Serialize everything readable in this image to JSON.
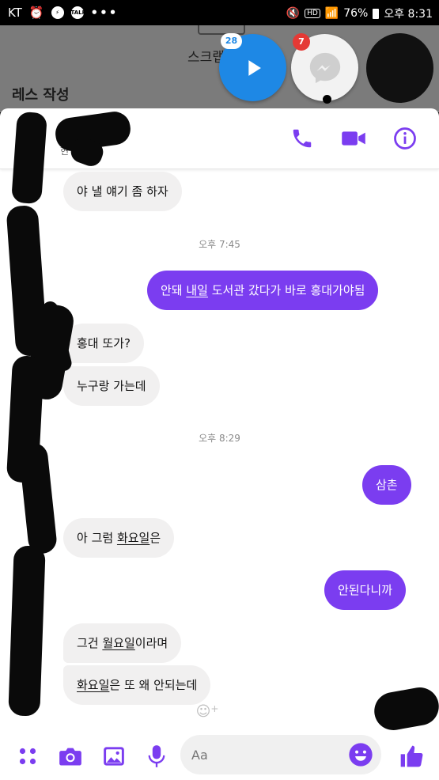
{
  "status_bar": {
    "carrier": "KT",
    "battery": "76%",
    "time": "오후 8:31",
    "talk_icon_label": "TALK",
    "hd_label": "HD",
    "more": "•••"
  },
  "background_app": {
    "scrap_label": "스크랩",
    "title": "레스 작성"
  },
  "chat_heads": {
    "video_badge": "28",
    "messenger_badge": "7"
  },
  "header": {
    "status_partial": "현",
    "icons": [
      "phone-icon",
      "video-call-icon",
      "info-icon"
    ]
  },
  "accent_color": "#7b3df0",
  "messages": [
    {
      "side": "in",
      "text": "야 낼 얘기 좀 하자"
    },
    {
      "type": "timestamp",
      "text": "오후 7:45"
    },
    {
      "side": "out",
      "text_before": "안돼 ",
      "underlined": "내일",
      "text_after": " 도서관 갔다가 바로 홍대가야됨"
    },
    {
      "side": "in",
      "text": "홍대 또가?"
    },
    {
      "side": "in",
      "text": "누구랑 가는데"
    },
    {
      "type": "timestamp",
      "text": "오후 8:29"
    },
    {
      "side": "out",
      "text": "삼촌"
    },
    {
      "side": "in",
      "text_before": "아 그럼 ",
      "underlined": "화요일",
      "text_after": "은"
    },
    {
      "side": "out",
      "text": "안된다니까"
    },
    {
      "side": "in",
      "text_before": "그건 ",
      "underlined": "월요일",
      "text_after": "이라며"
    },
    {
      "side": "in",
      "text_before": "",
      "underlined": "화요일",
      "text_after": "은 또 왜 안되는데"
    }
  ],
  "composer": {
    "placeholder": "Aa",
    "icons": [
      "apps-icon",
      "camera-icon",
      "gallery-icon",
      "mic-icon",
      "emoji-icon",
      "thumbs-up-icon"
    ]
  }
}
